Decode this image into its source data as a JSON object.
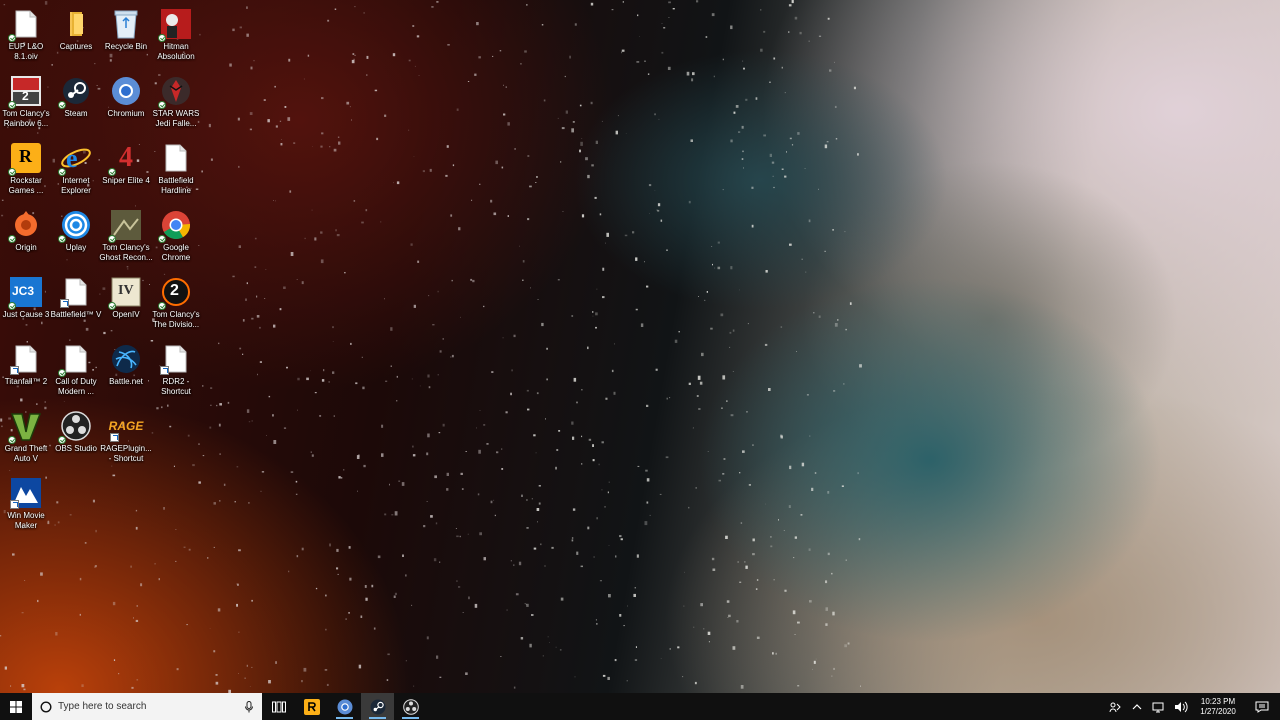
{
  "desktop": {
    "icons": [
      {
        "label": "EUP L&O 8.1.oiv",
        "glyph": "blank-document-icon"
      },
      {
        "label": "Captures",
        "glyph": "folder-icon"
      },
      {
        "label": "Recycle Bin",
        "glyph": "recycle-bin-icon"
      },
      {
        "label": "Hitman Absolution",
        "glyph": "hitman-icon"
      },
      {
        "label": "Tom Clancy's Rainbow 6...",
        "glyph": "rainbow-six-icon"
      },
      {
        "label": "Steam",
        "glyph": "steam-icon"
      },
      {
        "label": "Chromium",
        "glyph": "chromium-icon"
      },
      {
        "label": "STAR WARS Jedi Falle...",
        "glyph": "star-wars-icon"
      },
      {
        "label": "Rockstar Games ...",
        "glyph": "rockstar-icon"
      },
      {
        "label": "Internet Explorer",
        "glyph": "internet-explorer-icon"
      },
      {
        "label": "Sniper Elite 4",
        "glyph": "sniper-elite-icon"
      },
      {
        "label": "Battlefield Hardline",
        "glyph": "blank-document-icon"
      },
      {
        "label": "Origin",
        "glyph": "origin-icon"
      },
      {
        "label": "Uplay",
        "glyph": "uplay-icon"
      },
      {
        "label": "Tom Clancy's Ghost Recon...",
        "glyph": "ghost-recon-icon"
      },
      {
        "label": "Google Chrome",
        "glyph": "chrome-icon"
      },
      {
        "label": "Just Cause 3",
        "glyph": "just-cause-icon"
      },
      {
        "label": "Battlefield™ V",
        "glyph": "blank-document-icon"
      },
      {
        "label": "OpenIV",
        "glyph": "openiv-icon"
      },
      {
        "label": "Tom Clancy's The Divisio...",
        "glyph": "division-icon"
      },
      {
        "label": "Titanfall™ 2",
        "glyph": "blank-document-icon"
      },
      {
        "label": "Call of Duty Modern ...",
        "glyph": "blank-document-icon"
      },
      {
        "label": "Battle.net",
        "glyph": "battlenet-icon"
      },
      {
        "label": "RDR2 - Shortcut",
        "glyph": "blank-document-icon"
      },
      {
        "label": "Grand Theft Auto V",
        "glyph": "gta-icon"
      },
      {
        "label": "OBS Studio",
        "glyph": "obs-icon"
      },
      {
        "label": "RAGEPlugin... - Shortcut",
        "glyph": "rage-icon"
      },
      {
        "label": "Win Movie Maker",
        "glyph": "movie-maker-icon"
      }
    ],
    "icon_texts": {
      "rockstar": "R",
      "sniper": "4",
      "just_cause": "JC3",
      "openiv": "IV",
      "division": "2",
      "rage": "RAGE",
      "rainbow": "2"
    }
  },
  "taskbar": {
    "search_placeholder": "Type here to search",
    "pinned": [
      {
        "name": "task-view-icon"
      },
      {
        "name": "rockstar-launcher-icon"
      },
      {
        "name": "chromium-icon"
      },
      {
        "name": "steam-icon"
      },
      {
        "name": "obs-studio-icon"
      }
    ],
    "clock": {
      "time": "10:23 PM",
      "date": "1/27/2020"
    }
  },
  "colors": {
    "taskbar_bg": "#101010",
    "search_bg": "#f3f3f3",
    "running_indicator": "#76b9ed"
  }
}
